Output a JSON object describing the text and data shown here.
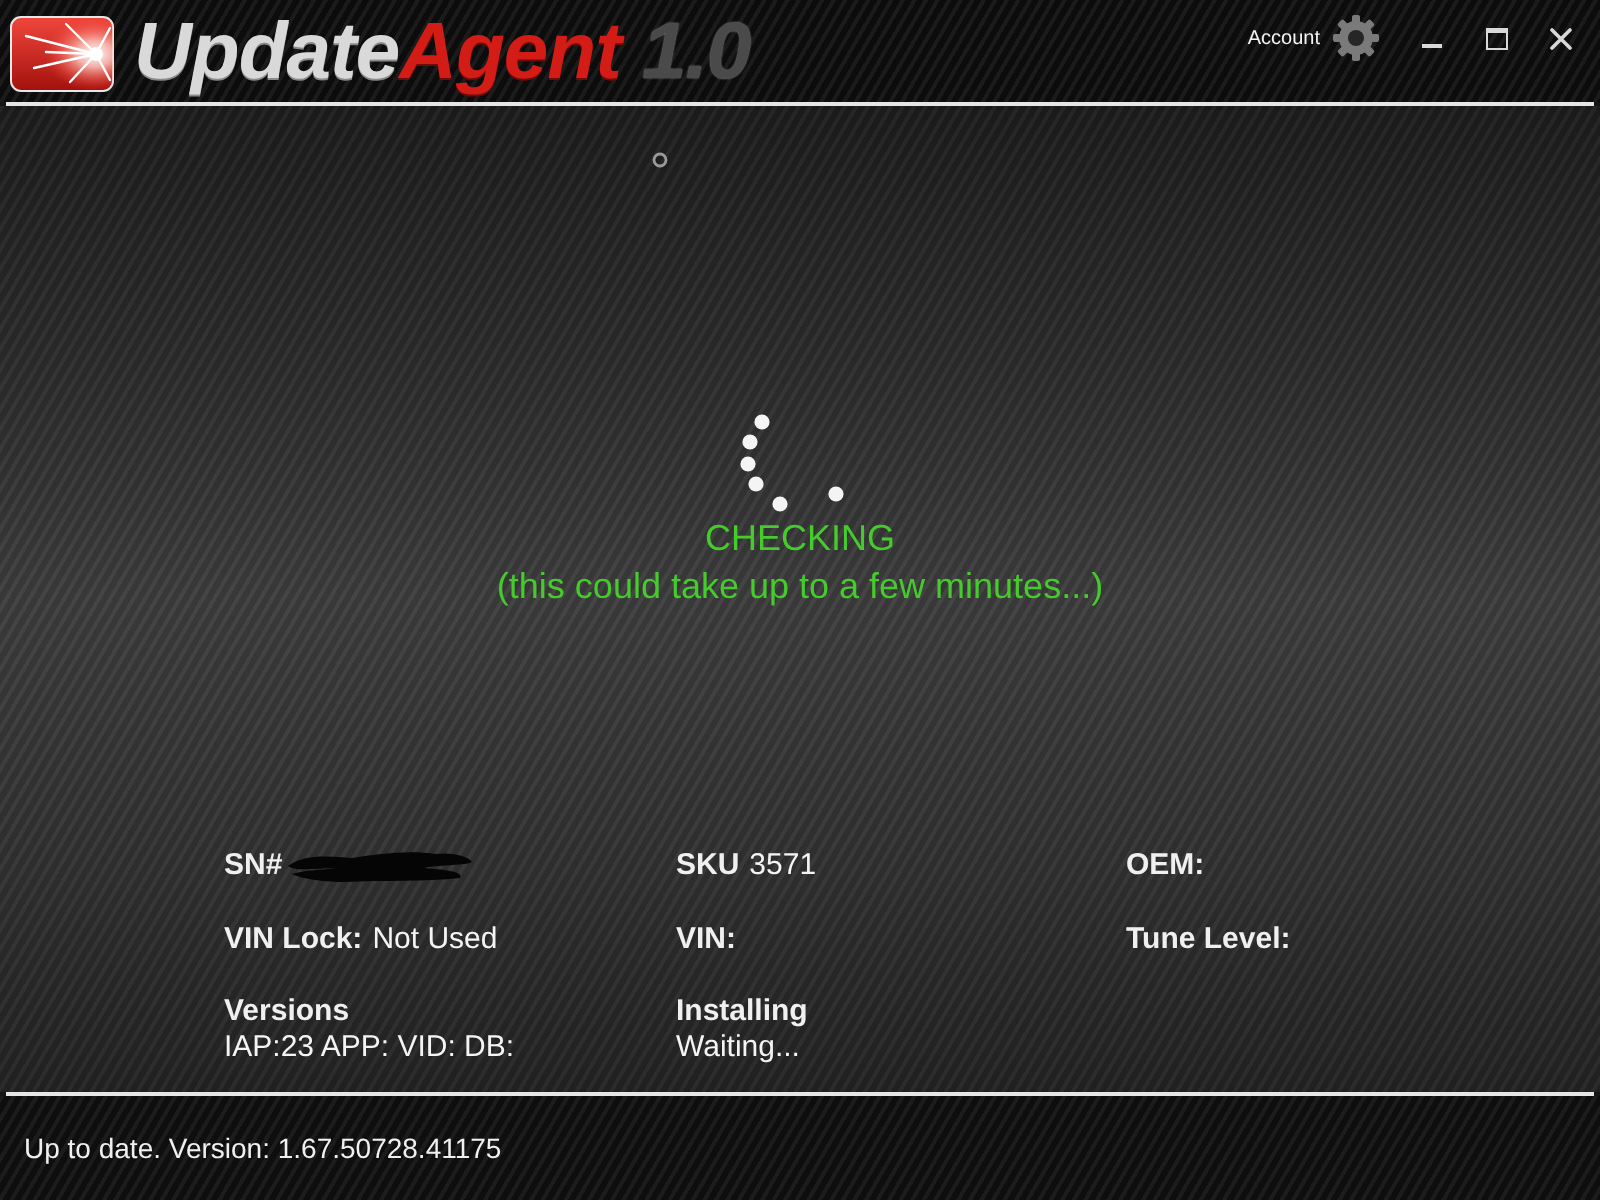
{
  "window": {
    "logo": {
      "primary": "Update",
      "accent": "Agent",
      "version": "1.0"
    },
    "account_label": "Account",
    "controls": [
      {
        "kind": "minimize"
      },
      {
        "kind": "maximize"
      },
      {
        "kind": "close"
      }
    ]
  },
  "status": {
    "title": "CHECKING",
    "message": "(this could take up to a few minutes...)"
  },
  "device_info": [
    {
      "kind": "inline",
      "label": "SN#",
      "redacted": true
    },
    {
      "kind": "inline",
      "label": "SKU",
      "value": "3571"
    },
    {
      "kind": "inline",
      "label": "OEM:"
    },
    {
      "kind": "inline",
      "label": "VIN Lock:",
      "value": "Not Used"
    },
    {
      "kind": "inline",
      "label": "VIN:"
    },
    {
      "kind": "inline",
      "label": "Tune Level:"
    },
    {
      "kind": "stacked",
      "label": "Versions",
      "value": "IAP:23 APP: VID: DB:"
    },
    {
      "kind": "stacked",
      "label": "Installing",
      "value": "Waiting..."
    }
  ],
  "status_bar": {
    "text": "Up to date. Version: 1.67.50728.41175"
  }
}
